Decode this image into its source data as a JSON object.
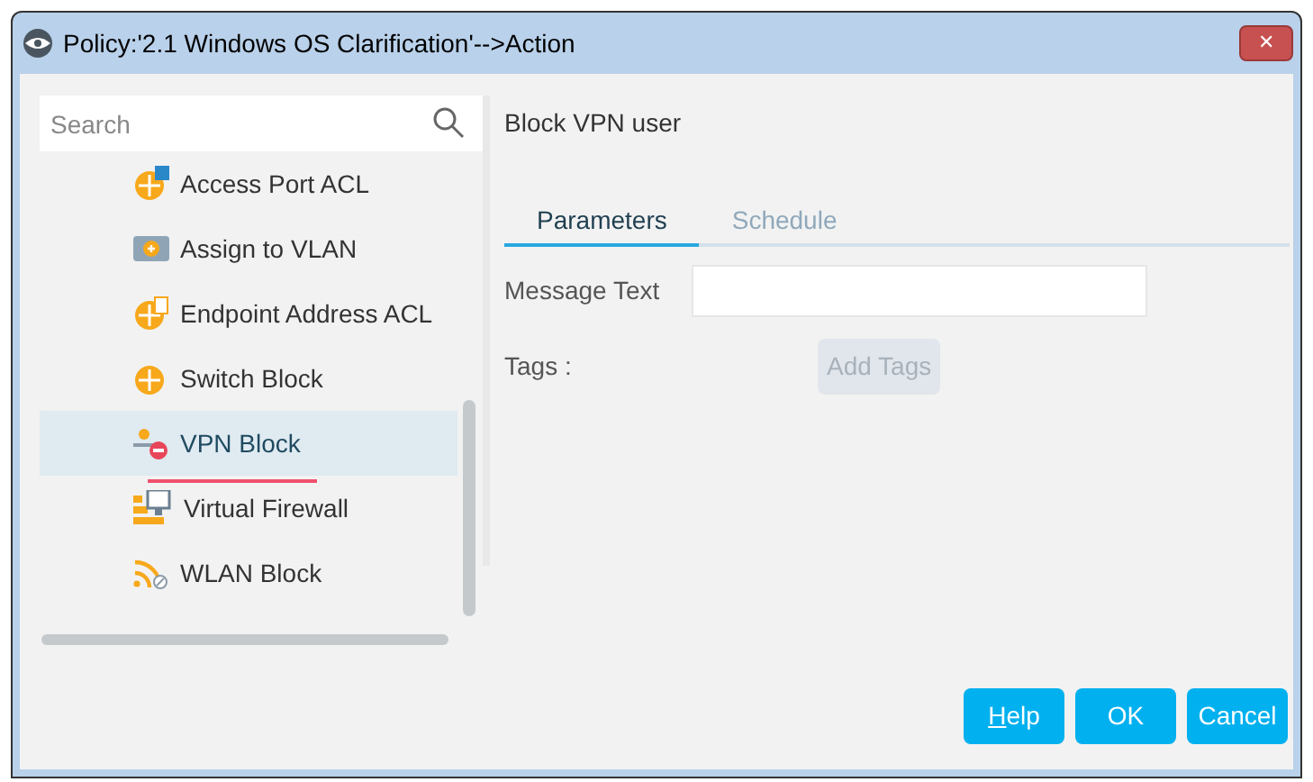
{
  "window": {
    "title": "Policy:'2.1 Windows OS Clarification'-->Action",
    "close_glyph": "✕"
  },
  "search": {
    "placeholder": "Search"
  },
  "actions": [
    {
      "label": "Access Port ACL",
      "kind": "port-acl",
      "selected": false
    },
    {
      "label": "Assign to VLAN",
      "kind": "vlan",
      "selected": false
    },
    {
      "label": "Endpoint Address ACL",
      "kind": "address-acl",
      "selected": false
    },
    {
      "label": "Switch Block",
      "kind": "switch",
      "selected": false
    },
    {
      "label": "VPN Block",
      "kind": "vpn",
      "selected": true
    },
    {
      "label": "Virtual Firewall",
      "kind": "firewall",
      "selected": false
    },
    {
      "label": "WLAN Block",
      "kind": "wlan",
      "selected": false
    }
  ],
  "detail": {
    "title": "Block VPN user"
  },
  "tabs": [
    {
      "label": "Parameters",
      "selected": true
    },
    {
      "label": "Schedule",
      "selected": false
    }
  ],
  "fields": [
    {
      "label": "Message Text",
      "kind": "text"
    },
    {
      "label": "Tags :",
      "kind": "tags",
      "button": "Add Tags",
      "disabled": true
    }
  ],
  "buttons": [
    {
      "label": "Help",
      "mnemonic_first": true
    },
    {
      "label": "OK"
    },
    {
      "label": "Cancel"
    }
  ]
}
